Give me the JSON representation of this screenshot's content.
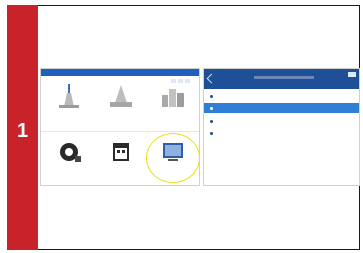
{
  "step": {
    "number": "1"
  },
  "left_screen": {
    "tiles": [
      {
        "icon": "monument-icon",
        "label": ""
      },
      {
        "icon": "building-icon",
        "label": ""
      },
      {
        "icon": "city-icon",
        "label": ""
      },
      {
        "icon": "settings-icon",
        "label": ""
      },
      {
        "icon": "calendar-icon",
        "label": ""
      },
      {
        "icon": "monitor-icon",
        "label": ""
      }
    ],
    "highlight_color": "#e8e21a"
  },
  "right_screen": {
    "title": "",
    "items": [
      {
        "label": "",
        "selected": false
      },
      {
        "label": "",
        "selected": true
      },
      {
        "label": "",
        "selected": false
      },
      {
        "label": "",
        "selected": false
      }
    ],
    "header_color": "#1f4f96",
    "selected_color": "#2f7fd6"
  },
  "accent_color": "#c8232b"
}
